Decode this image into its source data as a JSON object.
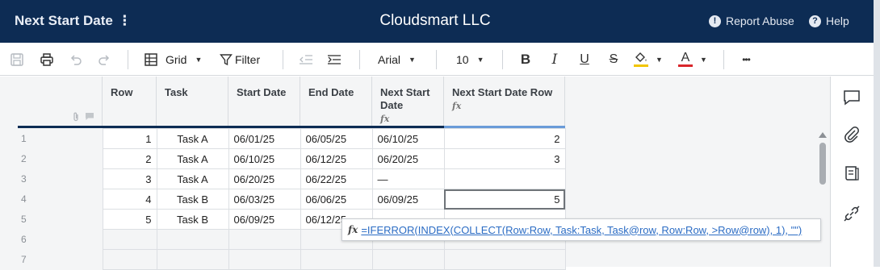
{
  "header": {
    "sheet_name": "Next Start Date",
    "menu_glyph": "⋮",
    "company": "Cloudsmart LLC",
    "report_abuse": "Report Abuse",
    "help": "Help"
  },
  "toolbar": {
    "view_label": "Grid",
    "filter_label": "Filter",
    "font_family": "Arial",
    "font_size": "10",
    "bold": "B",
    "italic": "I",
    "underline": "U",
    "strike": "S",
    "text_color": "A",
    "more": "•••"
  },
  "columns": [
    {
      "label": "Row",
      "has_formula": false
    },
    {
      "label": "Task",
      "has_formula": false
    },
    {
      "label": "Start Date",
      "has_formula": false
    },
    {
      "label": "End Date",
      "has_formula": false
    },
    {
      "label": "Next Start Date",
      "has_formula": true
    },
    {
      "label": "Next Start Date Row",
      "has_formula": true
    }
  ],
  "formula_glyph": "fx",
  "rows": [
    {
      "num": "1",
      "row": "1",
      "task": "Task A",
      "start": "06/01/25",
      "end": "06/05/25",
      "next_start": "06/10/25",
      "next_row": "2"
    },
    {
      "num": "2",
      "row": "2",
      "task": "Task A",
      "start": "06/10/25",
      "end": "06/12/25",
      "next_start": "06/20/25",
      "next_row": "3"
    },
    {
      "num": "3",
      "row": "3",
      "task": "Task A",
      "start": "06/20/25",
      "end": "06/22/25",
      "next_start": "—",
      "next_row": ""
    },
    {
      "num": "4",
      "row": "4",
      "task": "Task B",
      "start": "06/03/25",
      "end": "06/06/25",
      "next_start": "06/09/25",
      "next_row": "5"
    },
    {
      "num": "5",
      "row": "5",
      "task": "Task B",
      "start": "06/09/25",
      "end": "06/12/25",
      "next_start": "",
      "next_row": ""
    },
    {
      "num": "6"
    },
    {
      "num": "7"
    }
  ],
  "formula_tooltip": "=IFERROR(INDEX(COLLECT(Row:Row, Task:Task, Task@row, Row:Row, >Row@row), 1), \"\")",
  "colors": {
    "header_bg": "#0d2c54",
    "highlight_yellow": "#f2c500",
    "text_red": "#d9262b",
    "formula_link": "#2b6cc4"
  }
}
